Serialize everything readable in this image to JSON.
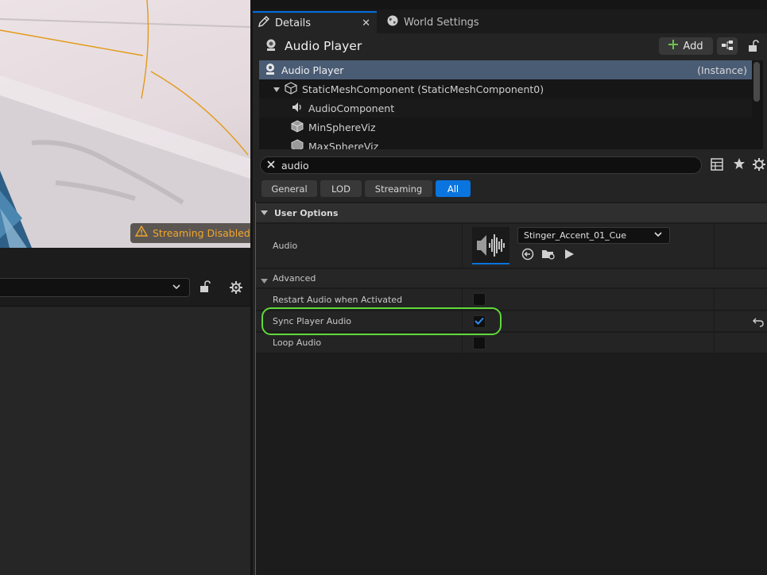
{
  "viewport": {
    "badge_text": "Streaming Disabled",
    "colors": {
      "badge_text": "#f2a62b",
      "spline": "#e39a18"
    }
  },
  "tabs": [
    {
      "label": "Details",
      "icon": "pencil-icon",
      "active": true
    },
    {
      "label": "World Settings",
      "icon": "globe-icon",
      "active": false
    }
  ],
  "header": {
    "title": "Audio Player",
    "add_label": "Add"
  },
  "tree": {
    "rows": [
      {
        "label": "Audio Player",
        "suffix": "(Instance)"
      },
      {
        "label": "StaticMeshComponent (StaticMeshComponent0)"
      },
      {
        "label": "AudioComponent"
      },
      {
        "label": "MinSphereViz"
      },
      {
        "label": "MaxSphereViz"
      }
    ]
  },
  "search": {
    "value": "audio"
  },
  "filters": [
    {
      "label": "General",
      "active": false
    },
    {
      "label": "LOD",
      "active": false
    },
    {
      "label": "Streaming",
      "active": false
    },
    {
      "label": "All",
      "active": true
    }
  ],
  "properties": {
    "category": "User Options",
    "audio_label": "Audio",
    "audio_asset": "Stinger_Accent_01_Cue",
    "advanced_label": "Advanced",
    "rows": [
      {
        "label": "Restart Audio when Activated",
        "checked": false
      },
      {
        "label": "Sync Player Audio",
        "checked": true
      },
      {
        "label": "Loop Audio",
        "checked": false
      }
    ]
  },
  "colors": {
    "accent": "#0a74df",
    "highlight": "#5fd93a",
    "selection": "#4a5b74"
  }
}
